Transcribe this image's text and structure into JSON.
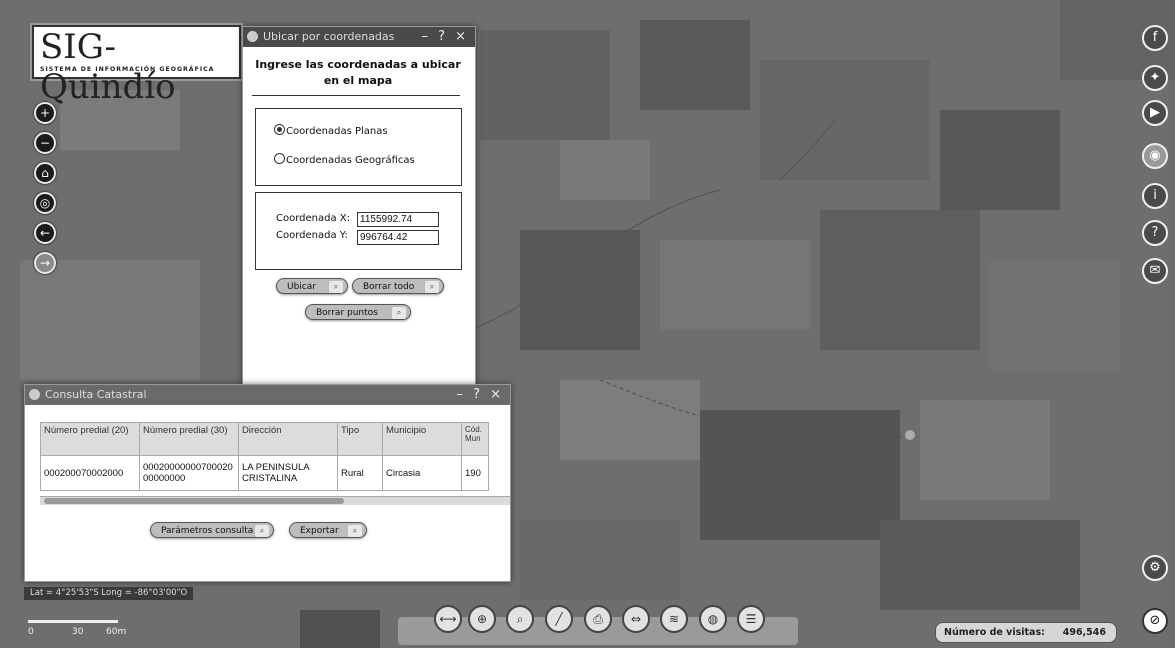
{
  "logo": {
    "title": "SIG-Quindío",
    "subtitle": "SISTEMA DE INFORMACIÓN GEOGRÁFICA"
  },
  "nav_icons": [
    "zoom-in-icon",
    "zoom-out-icon",
    "home-icon",
    "locate-icon",
    "back-arrow-icon",
    "forward-arrow-icon"
  ],
  "social_icons": [
    "facebook-icon",
    "twitter-icon",
    "youtube-icon",
    "globe-icon",
    "info-icon",
    "help-icon",
    "email-icon"
  ],
  "coord_window": {
    "title": "Ubicar por coordenadas",
    "controls": "– ? ×",
    "heading": "Ingrese las coordenadas a ubicar en el mapa",
    "radio_planas": "Coordenadas Planas",
    "radio_geograficas": "Coordenadas Geográficas",
    "selected": "planas",
    "x_label": "Coordenada X:",
    "x_value": "1155992.74",
    "y_label": "Coordenada Y:",
    "y_value": "996764.42",
    "btn_ubicar": "Ubicar",
    "btn_borrar_todo": "Borrar todo",
    "btn_borrar_puntos": "Borrar puntos"
  },
  "catastral_window": {
    "title": "Consulta Catastral",
    "controls": "– ? ×",
    "columns": [
      "Número predial (20)",
      "Número predial (30)",
      "Dirección",
      "Tipo",
      "Municipio",
      "Cód. Mun"
    ],
    "rows": [
      [
        "000200070002000",
        "0002000000070002000000000",
        "LA PENINSULA CRISTALINA",
        "Rural",
        "Circasia",
        "190"
      ]
    ],
    "btn_parametros": "Parámetros consulta",
    "btn_exportar": "Exportar"
  },
  "coords_readout": "Lat = 4°25'53\"S Long = -86°03'00\"O",
  "scale": {
    "zero": "0",
    "mid": "30",
    "end": "60m"
  },
  "bottom_tools": [
    "measure-icon",
    "identify-icon",
    "search-icon",
    "draw-icon",
    "print-icon",
    "swipe-icon",
    "layers-icon",
    "globe-icon",
    "list-icon"
  ],
  "visits": {
    "label": "Número de visitas:",
    "count": "496,546"
  },
  "colors": {
    "window_title_bg": "#4a4a4a",
    "map_base": "#6f6f6f",
    "button_bg": "#bdbdbd"
  }
}
